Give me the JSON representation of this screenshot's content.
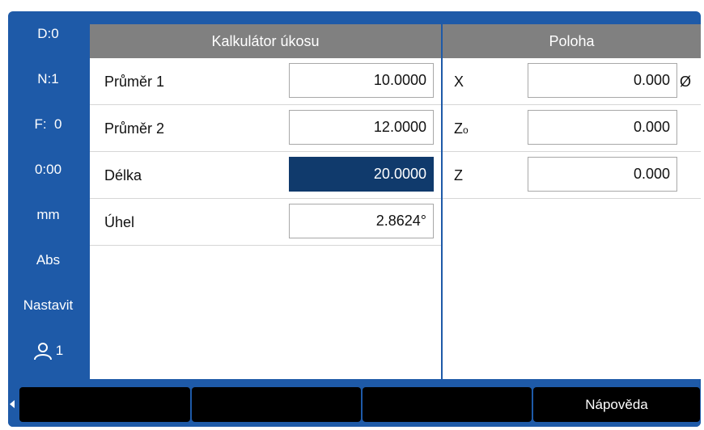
{
  "statusbar": {
    "datum": "D:0",
    "tool": "N:1",
    "feed": "F:  0",
    "timer": "0:00",
    "units": "mm",
    "mode": "Abs",
    "setup": "Nastavit",
    "user": "1",
    "user_icon": "user-icon"
  },
  "left_panel": {
    "title": "Kalkulátor úkosu",
    "rows": [
      {
        "label": "Průměr 1",
        "value": "10.0000"
      },
      {
        "label": "Průměr 2",
        "value": "12.0000"
      },
      {
        "label": "Délka",
        "value": "20.0000"
      },
      {
        "label": "Úhel",
        "value": "2.8624°"
      }
    ]
  },
  "right_panel": {
    "title": "Poloha",
    "rows": [
      {
        "axis": "X",
        "value": "0.000",
        "suffix": "Ø"
      },
      {
        "axis": "Z",
        "axis_sub": "o",
        "value": "0.000"
      },
      {
        "axis": "Z",
        "value": "0.000"
      }
    ]
  },
  "softkeys": {
    "key1": "",
    "key2": "",
    "key3": "",
    "help": "Nápověda"
  },
  "colors": {
    "frame": "#1e5aa8",
    "header": "#808080",
    "active_field": "#103a6c",
    "softkey": "#000000"
  }
}
